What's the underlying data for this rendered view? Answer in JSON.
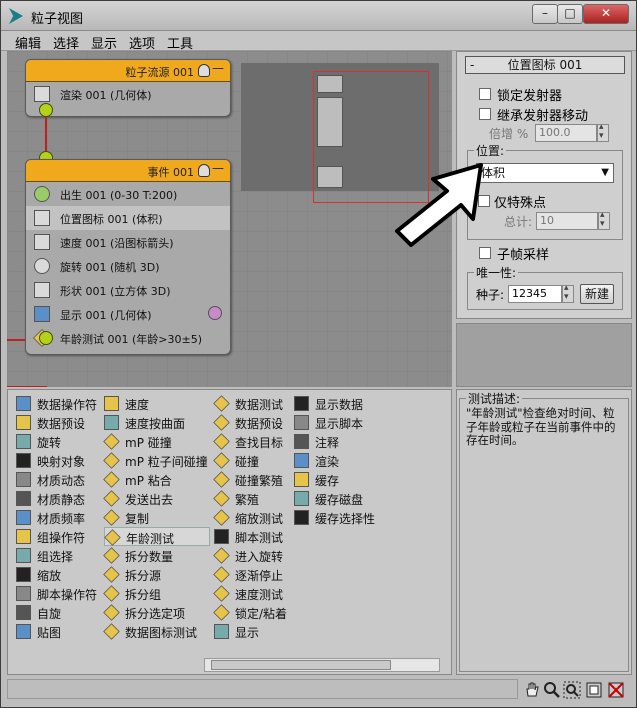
{
  "window": {
    "title": "粒子视图"
  },
  "menu": [
    "编辑",
    "选择",
    "显示",
    "选项",
    "工具"
  ],
  "colors": {
    "accent_orange": "#f0a81c",
    "wire_red": "#c0201e",
    "port_green": "#b5d219"
  },
  "nodes": {
    "source": {
      "title": "粒子流源 001",
      "ops": [
        {
          "label": "渲染 001 (几何体)",
          "icon": "render-icon"
        }
      ]
    },
    "event": {
      "title": "事件 001",
      "ops": [
        {
          "label": "出生 001 (0-30 T:200)",
          "icon": "birth-icon"
        },
        {
          "label": "位置图标 001 (体积)",
          "icon": "position-icon-icon",
          "selected": true
        },
        {
          "label": "速度 001 (沿图标箭头)",
          "icon": "speed-icon"
        },
        {
          "label": "旋转 001 (随机 3D)",
          "icon": "rotation-icon"
        },
        {
          "label": "形状 001 (立方体 3D)",
          "icon": "shape-icon"
        },
        {
          "label": "显示 001 (几何体)",
          "icon": "display-icon"
        },
        {
          "label": "年龄测试 001 (年龄>30±5)",
          "icon": "age-test-icon"
        }
      ]
    }
  },
  "rollout": {
    "title": "位置图标 001",
    "lock_emitter": "锁定发射器",
    "inherit_emitter_move": "继承发射器移动",
    "multiplier_label": "倍增 %",
    "multiplier_value": "100.0",
    "location_group": "位置:",
    "location_value": "体积",
    "distinct_points": "仅特殊点",
    "total_label": "总计:",
    "total_value": "10",
    "subframe_sampling": "子帧采样",
    "uniqueness_group": "唯一性:",
    "seed_label": "种子:",
    "seed_value": "12345",
    "new_button": "新建"
  },
  "depot": {
    "col1": [
      {
        "label": "数据操作符",
        "icon": "data-operator-icon"
      },
      {
        "label": "数据预设",
        "icon": "data-preset-icon"
      },
      {
        "label": "旋转",
        "icon": "rotation-icon"
      },
      {
        "label": "映射对象",
        "icon": "map-object-icon"
      },
      {
        "label": "材质动态",
        "icon": "material-dynamic-icon"
      },
      {
        "label": "材质静态",
        "icon": "material-static-icon"
      },
      {
        "label": "材质频率",
        "icon": "material-frequency-icon"
      },
      {
        "label": "组操作符",
        "icon": "group-operator-icon"
      },
      {
        "label": "组选择",
        "icon": "group-select-icon"
      },
      {
        "label": "缩放",
        "icon": "scale-icon"
      },
      {
        "label": "脚本操作符",
        "icon": "script-operator-icon"
      },
      {
        "label": "自旋",
        "icon": "spin-icon"
      },
      {
        "label": "贴图",
        "icon": "map-icon"
      }
    ],
    "col2": [
      {
        "label": "速度",
        "icon": "speed-icon"
      },
      {
        "label": "速度按曲面",
        "icon": "speed-by-surface-icon"
      },
      {
        "label": "mP 碰撞",
        "icon": "mp-collision-icon"
      },
      {
        "label": "mP 粒子间碰撞",
        "icon": "mp-interparticle-icon"
      },
      {
        "label": "mP 粘合",
        "icon": "mp-glue-icon"
      },
      {
        "label": "发送出去",
        "icon": "send-out-icon"
      },
      {
        "label": "复制",
        "icon": "copy-icon"
      },
      {
        "label": "年龄测试",
        "icon": "age-test-icon",
        "selected": true
      },
      {
        "label": "拆分数量",
        "icon": "split-amount-icon"
      },
      {
        "label": "拆分源",
        "icon": "split-source-icon"
      },
      {
        "label": "拆分组",
        "icon": "split-group-icon"
      },
      {
        "label": "拆分选定项",
        "icon": "split-selected-icon"
      },
      {
        "label": "数据图标测试",
        "icon": "data-icon-test-icon"
      }
    ],
    "col3": [
      {
        "label": "数据测试",
        "icon": "data-test-icon"
      },
      {
        "label": "数据预设",
        "icon": "data-preset-icon"
      },
      {
        "label": "查找目标",
        "icon": "find-target-icon"
      },
      {
        "label": "碰撞",
        "icon": "collision-icon"
      },
      {
        "label": "碰撞繁殖",
        "icon": "collision-spawn-icon"
      },
      {
        "label": "繁殖",
        "icon": "spawn-icon"
      },
      {
        "label": "缩放测试",
        "icon": "scale-test-icon"
      },
      {
        "label": "脚本测试",
        "icon": "script-test-icon"
      },
      {
        "label": "进入旋转",
        "icon": "go-to-rotation-icon"
      },
      {
        "label": "逐渐停止",
        "icon": "lock-bond-icon"
      },
      {
        "label": "速度测试",
        "icon": "speed-test-icon"
      },
      {
        "label": "锁定/粘着",
        "icon": "lock-stick-icon"
      },
      {
        "label": "显示",
        "icon": "display-icon"
      }
    ],
    "col4": [
      {
        "label": "显示数据",
        "icon": "display-data-icon"
      },
      {
        "label": "显示脚本",
        "icon": "display-script-icon"
      },
      {
        "label": "注释",
        "icon": "notes-icon"
      },
      {
        "label": "渲染",
        "icon": "render-icon"
      },
      {
        "label": "缓存",
        "icon": "cache-icon"
      },
      {
        "label": "缓存磁盘",
        "icon": "cache-disk-icon"
      },
      {
        "label": "缓存选择性",
        "icon": "cache-selective-icon"
      }
    ]
  },
  "description": {
    "title": "测试描述:",
    "text": "\"年龄测试\"检查绝对时间、粒子年龄或粒子在当前事件中的存在时间。"
  },
  "toolbar_icons": [
    "pan-icon",
    "zoom-icon",
    "zoom-region-icon",
    "zoom-extents-icon",
    "no-display-icon"
  ]
}
